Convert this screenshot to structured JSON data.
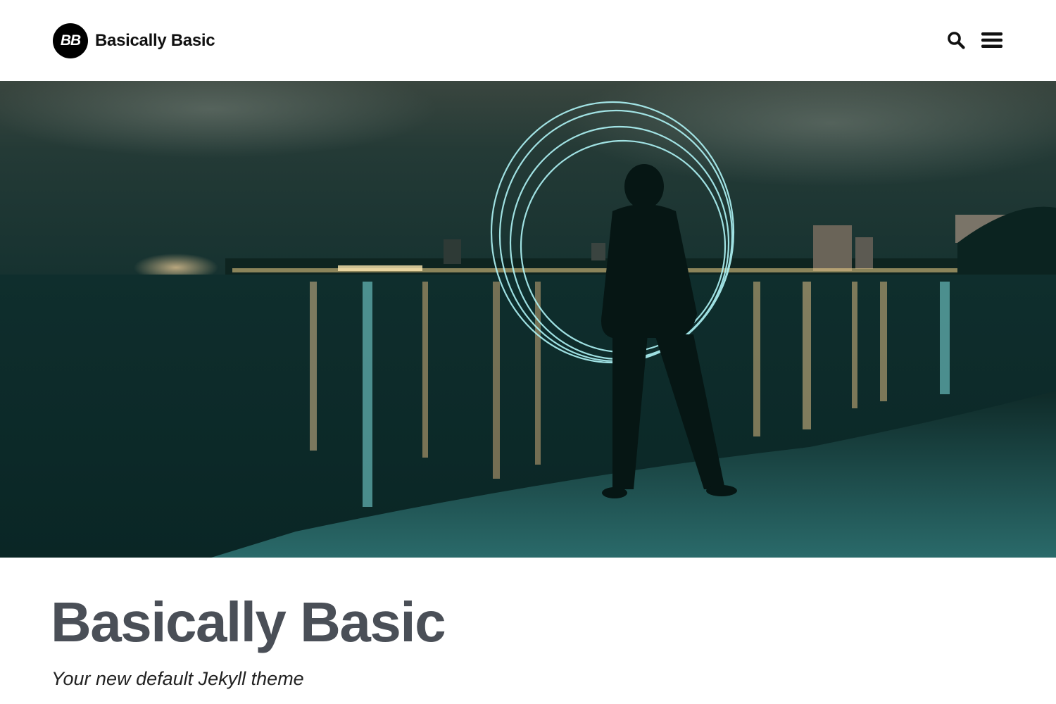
{
  "header": {
    "logo_text": "BB",
    "site_title": "Basically Basic",
    "search_icon": "search-icon",
    "menu_icon": "hamburger-menu-icon"
  },
  "hero": {
    "image_subject": "person with light-painted circle on beach at night with city lights reflecting on water"
  },
  "page": {
    "title": "Basically Basic",
    "subtitle": "Your new default Jekyll theme"
  },
  "colors": {
    "title_text": "#4a4f57",
    "subtitle_text": "#222222",
    "logo_bg": "#000000"
  }
}
